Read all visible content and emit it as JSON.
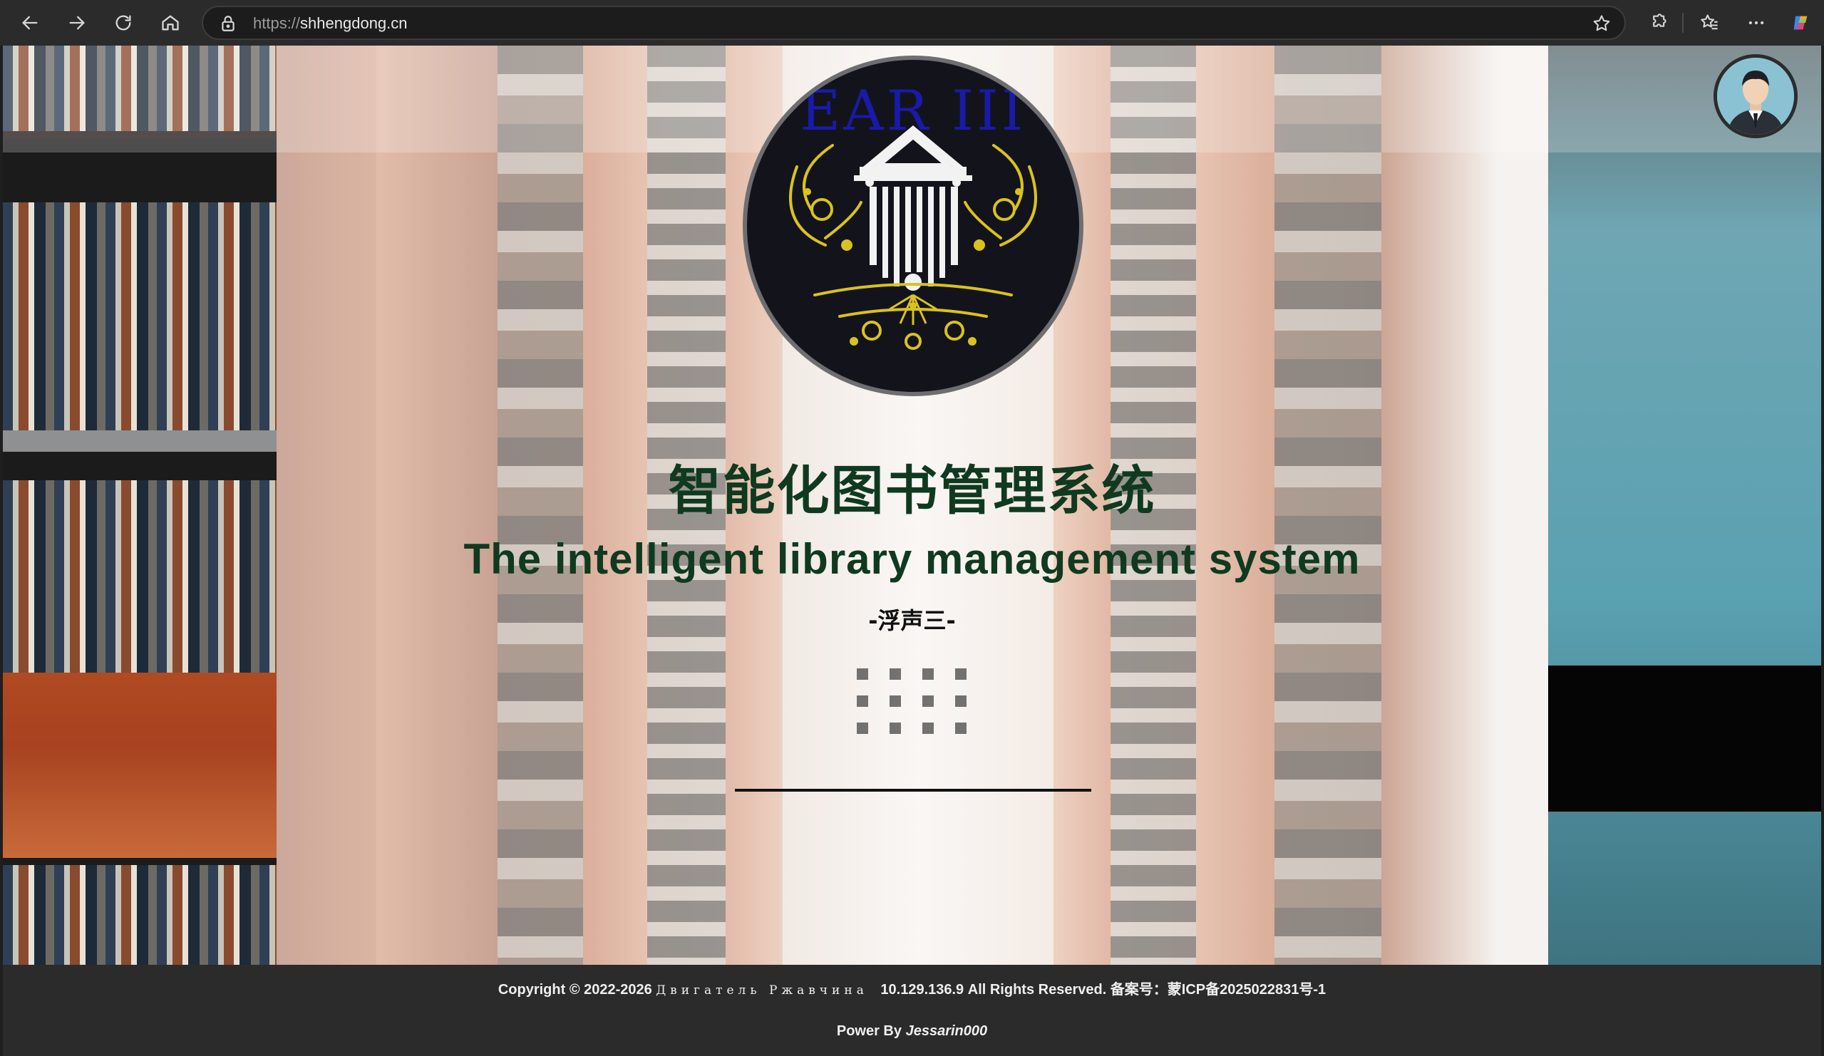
{
  "browser": {
    "url_protocol": "https://",
    "url_host": "shhengdong.cn"
  },
  "logo": {
    "text": "EAR III"
  },
  "hero": {
    "title_cn": "智能化图书管理系统",
    "title_en": "The intelligent library management system",
    "subtitle": "-浮声三-"
  },
  "footer": {
    "copyright_prefix": "Copyright © 2022-2026",
    "author_cyrillic": "Двигатель Ржавчина",
    "ip": "10.129.136.9",
    "rights": "All Rights Reserved. 备案号：蒙ICP备2025022831号-1",
    "power_prefix": "Power By",
    "power_name": "Jessarin000"
  },
  "icons": {
    "back": "arrow-left-icon",
    "forward": "arrow-right-icon",
    "reload": "reload-icon",
    "home": "home-icon",
    "lock": "lock-icon",
    "favorite": "star-icon",
    "extensions": "puzzle-icon",
    "favorites_list": "favorites-icon",
    "menu": "more-icon",
    "copilot": "copilot-icon"
  },
  "colors": {
    "title": "#0f3a1f",
    "logo_text": "#1a1aa8",
    "logo_gold": "#d9c21e",
    "footer_bg": "#2b2b2b"
  }
}
